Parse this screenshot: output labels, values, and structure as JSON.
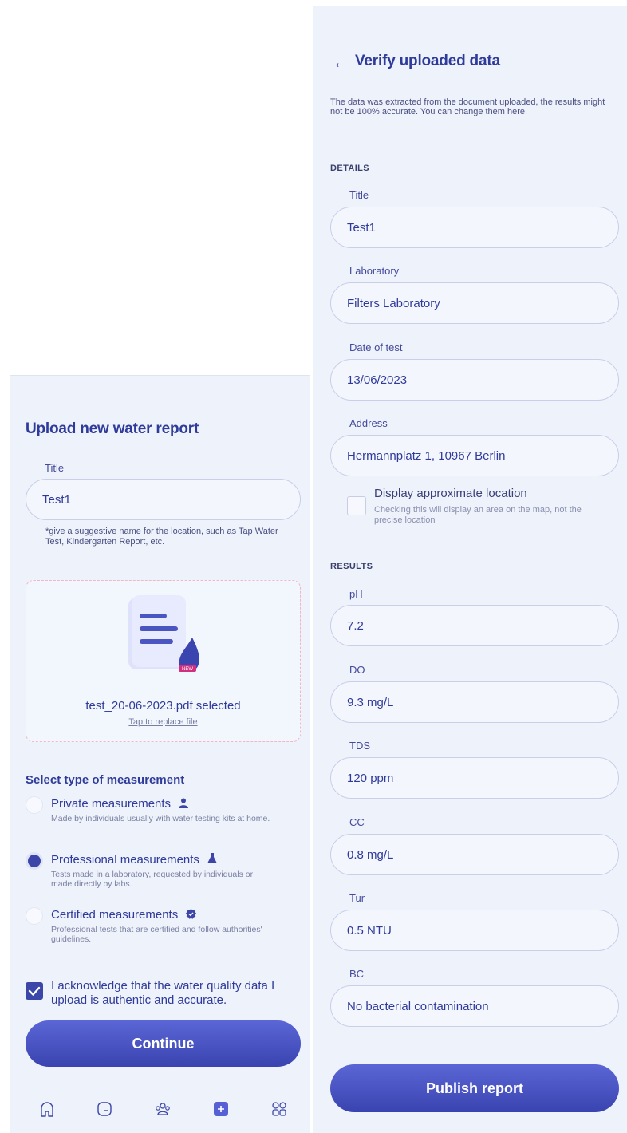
{
  "upload_screen": {
    "title": "Upload new water report",
    "title_field": {
      "label": "Title",
      "value": "Test1"
    },
    "hint": "*give a suggestive name for the location, such as Tap Water Test, Kindergarten Report, etc.",
    "file": {
      "name": "test_20-06-2023.pdf selected",
      "replace": "Tap to replace file",
      "badge": "NEW"
    },
    "measurement": {
      "title": "Select type of measurement",
      "options": [
        {
          "title": "Private measurements",
          "desc": "Made by individuals usually with water testing kits at home.",
          "icon": "person-icon",
          "selected": false
        },
        {
          "title": "Professional measurements",
          "desc": "Tests made in a laboratory, requested by individuals or made directly by labs.",
          "icon": "flask-icon",
          "selected": true
        },
        {
          "title": "Certified measurements",
          "desc": "Professional tests that are certified and follow authorities' guidelines.",
          "icon": "verified-badge-icon",
          "selected": false
        }
      ]
    },
    "acknowledge": {
      "text": "I acknowledge that the water quality data I upload is authentic and accurate.",
      "checked": true
    },
    "continue_label": "Continue",
    "nav": [
      "home-icon",
      "wallet-icon",
      "community-icon",
      "add-report-icon",
      "apps-grid-icon"
    ]
  },
  "verify_screen": {
    "back": "←",
    "title": "Verify uploaded data",
    "description": "The data was extracted from the document uploaded, the results might not be 100% accurate. You can change them here.",
    "details_caption": "DETAILS",
    "details": [
      {
        "label": "Title",
        "value": "Test1"
      },
      {
        "label": "Laboratory",
        "value": "Filters Laboratory"
      },
      {
        "label": "Date of test",
        "value": "13/06/2023"
      },
      {
        "label": "Address",
        "value": "Hermannplatz 1, 10967 Berlin"
      }
    ],
    "location": {
      "title": "Display approximate location",
      "desc": "Checking this will display an area on the map, not the precise location",
      "checked": false
    },
    "results_caption": "RESULTS",
    "results": [
      {
        "label": "pH",
        "value": "7.2"
      },
      {
        "label": "DO",
        "value": "9.3 mg/L"
      },
      {
        "label": "TDS",
        "value": "120 ppm"
      },
      {
        "label": "CC",
        "value": "0.8 mg/L"
      },
      {
        "label": "Tur",
        "value": "0.5 NTU"
      },
      {
        "label": "BC",
        "value": "No bacterial contamination"
      }
    ],
    "publish_label": "Publish report"
  },
  "colors": {
    "primary": "#3c46a8",
    "accent_pink": "#f2b6c9",
    "background": "#eef2fb"
  }
}
